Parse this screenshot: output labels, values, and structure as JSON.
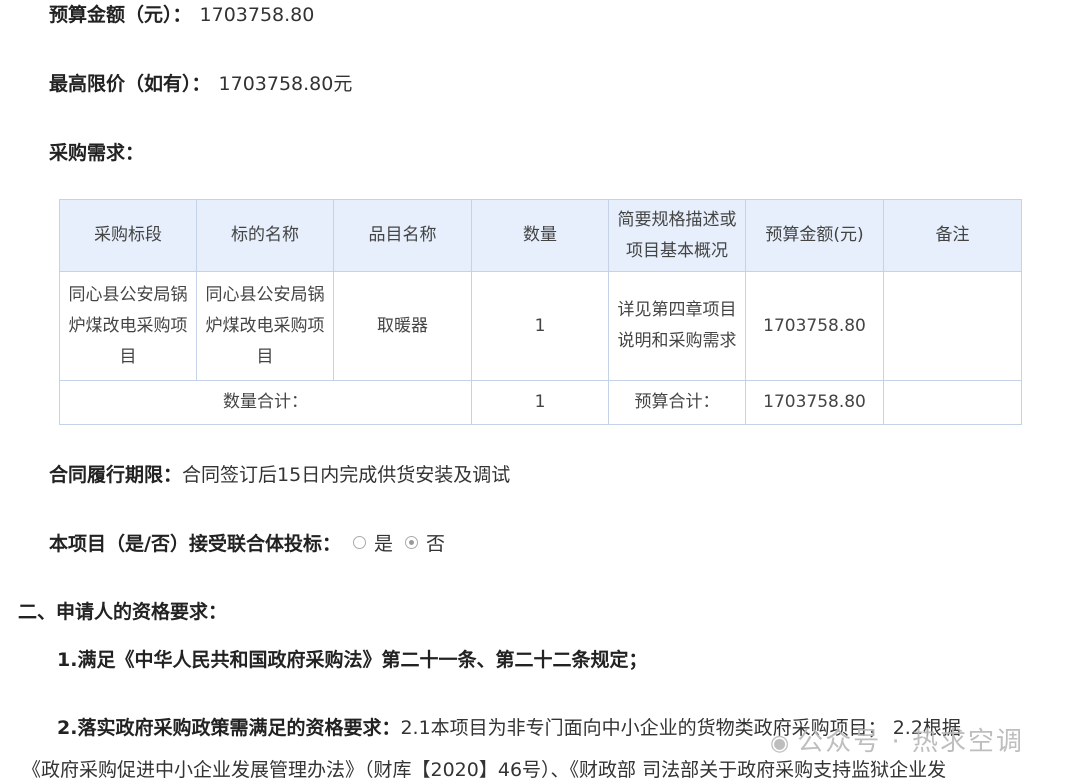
{
  "budget": {
    "label": "预算金额（元）：",
    "value": "1703758.80"
  },
  "max_price": {
    "label": "最高限价（如有）：",
    "value": "1703758.80元"
  },
  "requirement_heading": "采购需求：",
  "table": {
    "headers": [
      "采购标段",
      "标的名称",
      "品目名称",
      "数量",
      "简要规格描述或项目基本概况",
      "预算金额(元)",
      "备注"
    ],
    "row": {
      "section": "同心县公安局锅炉煤改电采购项目",
      "subject": "同心县公安局锅炉煤改电采购项目",
      "category": "取暖器",
      "quantity": "1",
      "spec": "详见第四章项目说明和采购需求",
      "budget": "1703758.80",
      "remark": ""
    },
    "total": {
      "qty_label": "数量合计：",
      "qty_value": "1",
      "budget_label": "预算合计：",
      "budget_value": "1703758.80"
    }
  },
  "contract": {
    "label": "合同履行期限：",
    "value": "合同签订后15日内完成供货安装及调试"
  },
  "consortium": {
    "label": "本项目（是/否）接受联合体投标：",
    "yes": "是",
    "no": "否",
    "selected": "否"
  },
  "section2_heading": "二、申请人的资格要求：",
  "req1": "1.满足《中华人民共和国政府采购法》第二十一条、第二十二条规定；",
  "req2": {
    "label": "2.落实政府采购政策需满足的资格要求：",
    "text": "2.1本项目为非专门面向中小企业的货物类政府采购项目； 2.2根据"
  },
  "req2_cont": "《政府采购促进中小企业发展管理办法》（财库【2020】46号）、《财政部 司法部关于政府采购支持监狱企业发",
  "watermark": "公众号 · 热求空调"
}
